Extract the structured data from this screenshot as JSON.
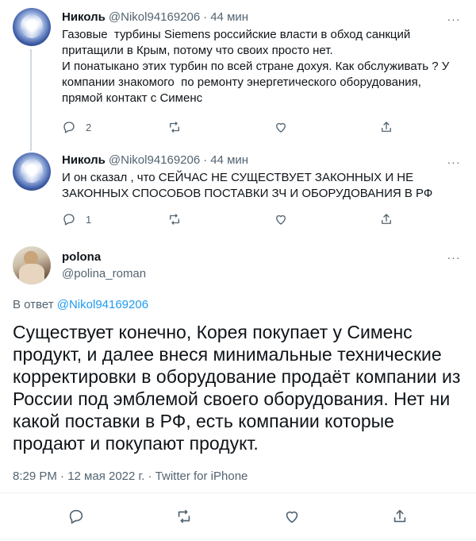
{
  "tweets": [
    {
      "author": "Николь",
      "handle": "@Nikol94169206",
      "time": "44 мин",
      "text": "Газовые  турбины Siemens российские власти в обход санкций притащили в Крым, потому что своих просто нет.\nИ понатыкано этих турбин по всей стране дохуя. Как обслуживать ? У компании знакомого  по ремонту энергетического оборудования, прямой контакт с Сименс",
      "reply_count": "2",
      "retweet_count": "",
      "like_count": ""
    },
    {
      "author": "Николь",
      "handle": "@Nikol94169206",
      "time": "44 мин",
      "text": "И он сказал , что СЕЙЧАС НЕ СУЩЕСТВУЕТ ЗАКОННЫХ И НЕ ЗАКОННЫХ СПОСОБОВ ПОСТАВКИ ЗЧ И ОБОРУДОВАНИЯ В РФ",
      "reply_count": "1",
      "retweet_count": "",
      "like_count": ""
    }
  ],
  "main_tweet": {
    "author": "polona",
    "handle": "@polina_roman",
    "reply_prefix": "В ответ",
    "reply_to": "@Nikol94169206",
    "text": "Существует конечно, Корея покупает у Сименс продукт, и далее внеся минимальные технические корректировки в оборудование продаёт компании из России под эмблемой своего оборудования. Нет ни какой поставки в РФ, есть компании которые продают и покупают продукт.",
    "timestamp": "8:29 PM · 12 мая 2022 г. · ",
    "source": "Twitter for iPhone"
  },
  "ui": {
    "more_glyph": "···",
    "separator_dot": "·"
  },
  "icons": {
    "reply": "reply-icon",
    "retweet": "retweet-icon",
    "like": "like-icon",
    "share": "share-icon",
    "more": "more-icon"
  },
  "colors": {
    "link": "#1d9bf0",
    "secondary_text": "#536471",
    "primary_text": "#0f1419",
    "divider": "#eff3f4"
  }
}
